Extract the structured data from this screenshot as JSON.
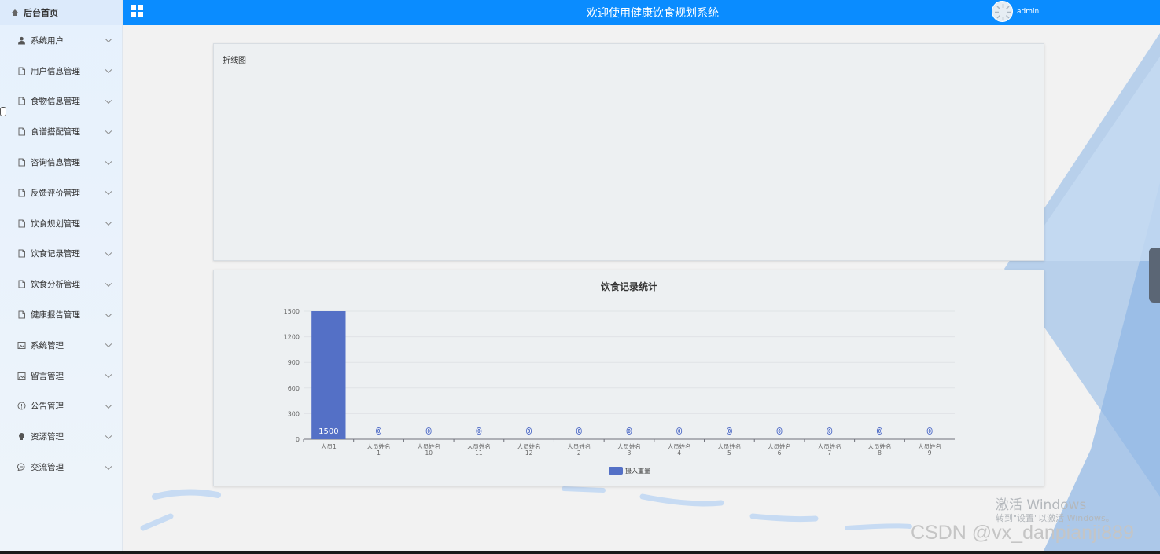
{
  "sidebar": {
    "home_label": "后台首页",
    "items": [
      {
        "label": "系统用户",
        "icon": "user-icon"
      },
      {
        "label": "用户信息管理",
        "icon": "document-icon"
      },
      {
        "label": "食物信息管理",
        "icon": "document-icon"
      },
      {
        "label": "食谱搭配管理",
        "icon": "document-icon"
      },
      {
        "label": "咨询信息管理",
        "icon": "document-icon"
      },
      {
        "label": "反馈评价管理",
        "icon": "document-icon"
      },
      {
        "label": "饮食规划管理",
        "icon": "document-icon"
      },
      {
        "label": "饮食记录管理",
        "icon": "document-icon"
      },
      {
        "label": "饮食分析管理",
        "icon": "document-icon"
      },
      {
        "label": "健康报告管理",
        "icon": "document-icon"
      },
      {
        "label": "系统管理",
        "icon": "picture-icon"
      },
      {
        "label": "留言管理",
        "icon": "picture-icon"
      },
      {
        "label": "公告管理",
        "icon": "info-icon"
      },
      {
        "label": "资源管理",
        "icon": "bulb-icon"
      },
      {
        "label": "交流管理",
        "icon": "chat-icon"
      }
    ]
  },
  "header": {
    "title": "欢迎使用健康饮食规划系统",
    "username": "admin"
  },
  "line_card": {
    "title": "折线图"
  },
  "chart_data": {
    "type": "bar",
    "title": "饮食记录统计",
    "categories": [
      "人员1",
      "人员姓名1",
      "人员姓名10",
      "人员姓名11",
      "人员姓名12",
      "人员姓名2",
      "人员姓名3",
      "人员姓名4",
      "人员姓名5",
      "人员姓名6",
      "人员姓名7",
      "人员姓名8",
      "人员姓名9"
    ],
    "category_lines": [
      [
        "人员1"
      ],
      [
        "人员姓名",
        "1"
      ],
      [
        "人员姓名",
        "10"
      ],
      [
        "人员姓名",
        "11"
      ],
      [
        "人员姓名",
        "12"
      ],
      [
        "人员姓名",
        "2"
      ],
      [
        "人员姓名",
        "3"
      ],
      [
        "人员姓名",
        "4"
      ],
      [
        "人员姓名",
        "5"
      ],
      [
        "人员姓名",
        "6"
      ],
      [
        "人员姓名",
        "7"
      ],
      [
        "人员姓名",
        "8"
      ],
      [
        "人员姓名",
        "9"
      ]
    ],
    "series": [
      {
        "name": "摄入重量",
        "values": [
          1500,
          0,
          0,
          0,
          0,
          0,
          0,
          0,
          0,
          0,
          0,
          0,
          0
        ]
      }
    ],
    "yticks": [
      0,
      300,
      600,
      900,
      1200,
      1500
    ],
    "ylim": [
      0,
      1500
    ],
    "legend_position": "bottom-center",
    "color": "#5470c6",
    "grid": true
  },
  "watermarks": {
    "activate_title": "激活 Windows",
    "activate_sub": "转到\"设置\"以激活 Windows。",
    "csdn": "CSDN @vx_danpianji889"
  },
  "colors": {
    "header": "#0a8cff",
    "bar": "#5470c6"
  }
}
